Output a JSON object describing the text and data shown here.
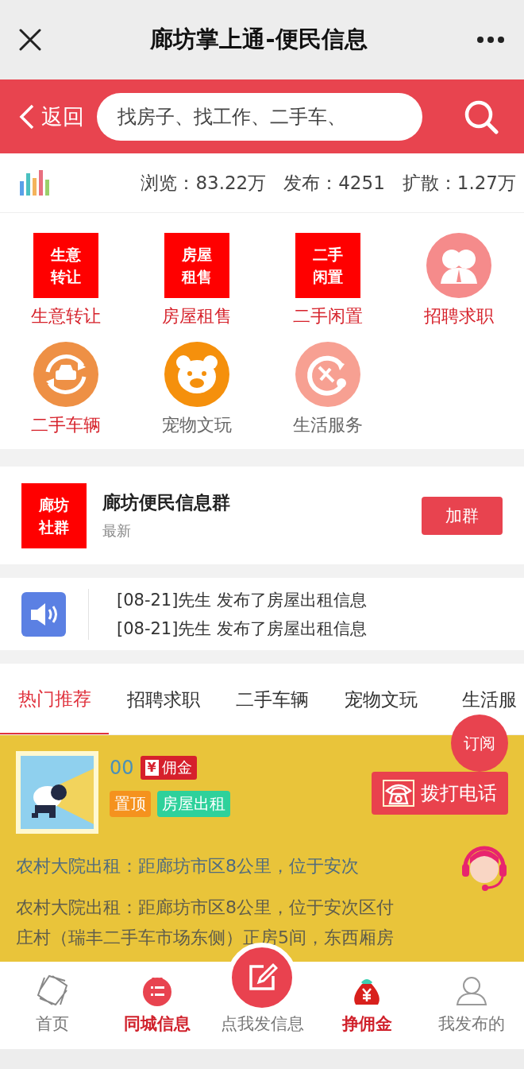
{
  "header": {
    "title": "廊坊掌上通-便民信息"
  },
  "search_bar": {
    "back": "返回",
    "placeholder": "找房子、找工作、二手车、"
  },
  "stats": [
    "浏览：83.22万",
    "发布：4251",
    "扩散：1.27万"
  ],
  "categories": [
    {
      "label": "生意转让",
      "kind": "tile",
      "tile_text": "生意转让",
      "highlighted": true
    },
    {
      "label": "房屋租售",
      "kind": "tile",
      "tile_text": "房屋租售",
      "highlighted": true
    },
    {
      "label": "二手闲置",
      "kind": "tile",
      "tile_text": "二手闲置",
      "highlighted": true
    },
    {
      "label": "招聘求职",
      "kind": "circle",
      "color": "#f58b8b",
      "highlighted": true
    },
    {
      "label": "二手车辆",
      "kind": "circle",
      "color": "#ee9045",
      "highlighted": true
    },
    {
      "label": "宠物文玩",
      "kind": "circle",
      "color": "#f5900c",
      "highlighted": false
    },
    {
      "label": "生活服务",
      "kind": "circle",
      "color": "#f7a092",
      "highlighted": false
    }
  ],
  "group": {
    "logo_text": "廊坊社群",
    "name": "廊坊便民信息群",
    "subtitle": "最新",
    "button": "加群"
  },
  "news": [
    "[08-21]先生 发布了房屋出租信息",
    "[08-21]先生 发布了房屋出租信息"
  ],
  "tabs": [
    {
      "label": "热门推荐",
      "selected": true
    },
    {
      "label": "招聘求职",
      "selected": false
    },
    {
      "label": "二手车辆",
      "selected": false
    },
    {
      "label": "宠物文玩",
      "selected": false
    },
    {
      "label": "生活服",
      "selected": false
    }
  ],
  "subscribe": "订阅",
  "listing": {
    "name": "00",
    "commission_sign": "¥",
    "commission": "佣金",
    "tags": [
      {
        "label": "置顶",
        "color": "#f5921e"
      },
      {
        "label": "房屋出租",
        "color": "#2ed19b"
      }
    ],
    "call_button": "拨打电话",
    "title": "农村大院出租：距廊坊市区8公里，位于安次",
    "description": [
      "农村大院出租：距廊坊市区8公里，位于安次区付",
      "庄村（瑞丰二手车市场东侧）正房5间，东西厢房"
    ]
  },
  "nav": [
    {
      "label": "首页",
      "kind": "tab",
      "highlighted": false
    },
    {
      "label": "同城信息",
      "kind": "tab",
      "highlighted": true
    },
    {
      "label": "点我发信息",
      "kind": "fab",
      "highlighted": false
    },
    {
      "label": "挣佣金",
      "kind": "tab",
      "highlighted": true
    },
    {
      "label": "我发布的",
      "kind": "tab",
      "highlighted": false
    }
  ]
}
